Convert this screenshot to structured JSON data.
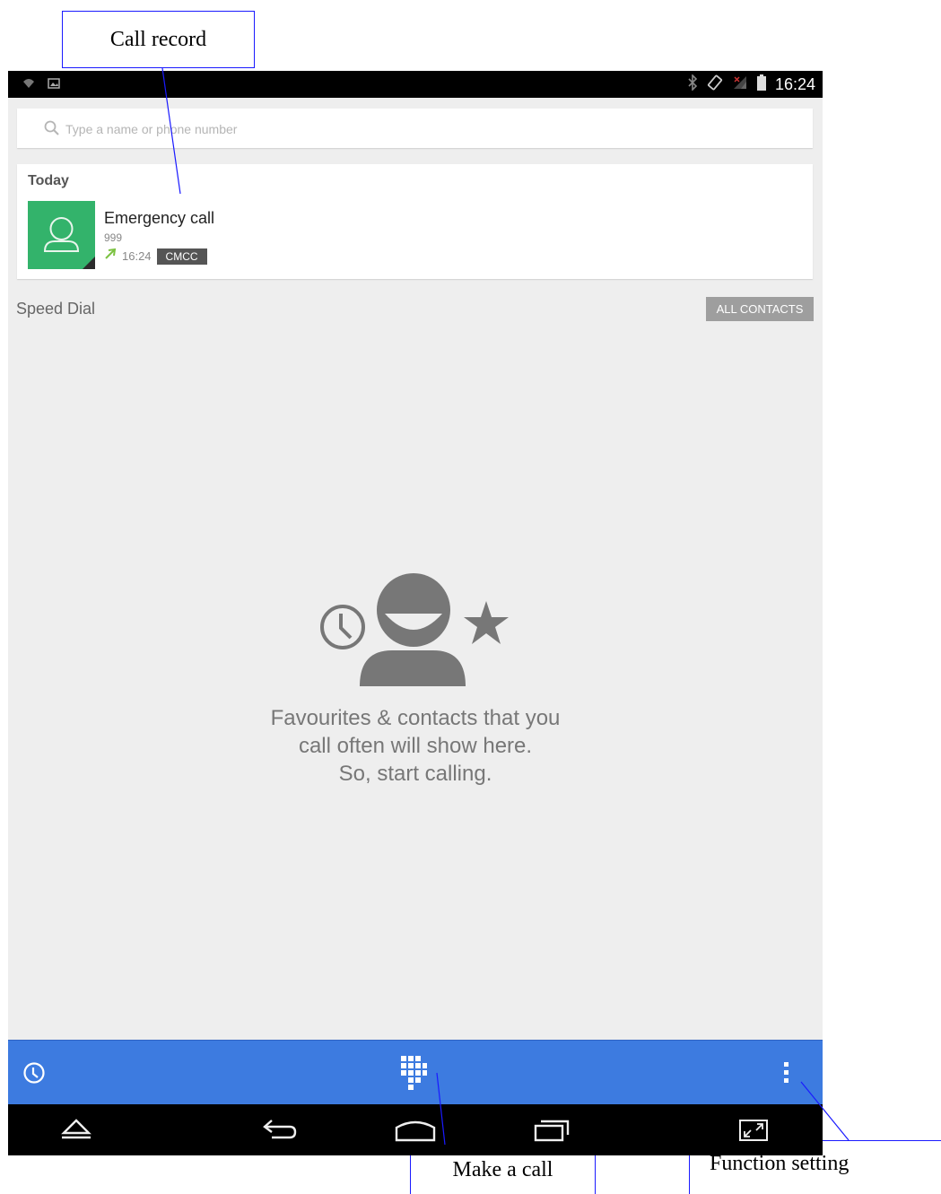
{
  "annotations": {
    "call_record": "Call record",
    "make_a_call": "Make a call",
    "function_setting": "Function setting"
  },
  "status_bar": {
    "time": "16:24",
    "icons": [
      "wifi-icon",
      "image-notification-icon",
      "bluetooth-icon",
      "rotation-icon",
      "signal-icon",
      "battery-icon"
    ]
  },
  "search": {
    "placeholder": "Type a name or phone number",
    "value": ""
  },
  "call_log": {
    "section_label": "Today",
    "entries": [
      {
        "name": "Emergency call",
        "number": "999",
        "time": "16:24",
        "sim": "CMCC",
        "direction": "outgoing"
      }
    ]
  },
  "speed_dial": {
    "label": "Speed Dial",
    "all_contacts_label": "ALL CONTACTS",
    "empty_lines": [
      "Favourites & contacts that you",
      "call often will show here.",
      "So, start calling."
    ]
  },
  "action_bar": {
    "icons": [
      "recent-icon",
      "dialpad-icon",
      "overflow-menu-icon"
    ]
  },
  "nav_bar": {
    "icons": [
      "up-icon",
      "back-icon",
      "home-icon",
      "recents-icon",
      "fullscreen-icon"
    ]
  },
  "colors": {
    "action_bar": "#3d7be0",
    "avatar": "#33b36b",
    "outgoing_arrow": "#7cc242",
    "background": "#eeeeee"
  }
}
